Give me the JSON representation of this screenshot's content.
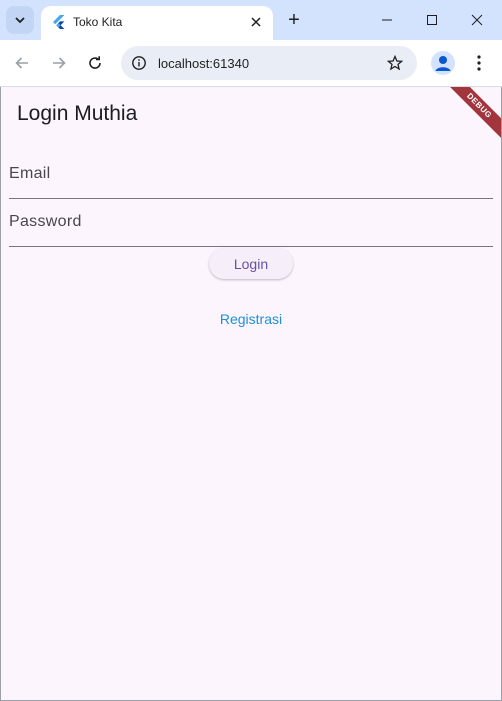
{
  "browser": {
    "tab_title": "Toko Kita",
    "url": "localhost:61340",
    "new_tab_label": "+"
  },
  "app": {
    "title": "Login Muthia",
    "debug_banner": "DEBUG",
    "email": {
      "label": "Email",
      "value": ""
    },
    "password": {
      "label": "Password",
      "value": ""
    },
    "login_button": "Login",
    "register_link": "Registrasi"
  },
  "colors": {
    "app_background": "#fcf5fd",
    "button_text": "#6750a4",
    "link": "#1e90d4",
    "debug_ribbon": "#a3353c"
  }
}
